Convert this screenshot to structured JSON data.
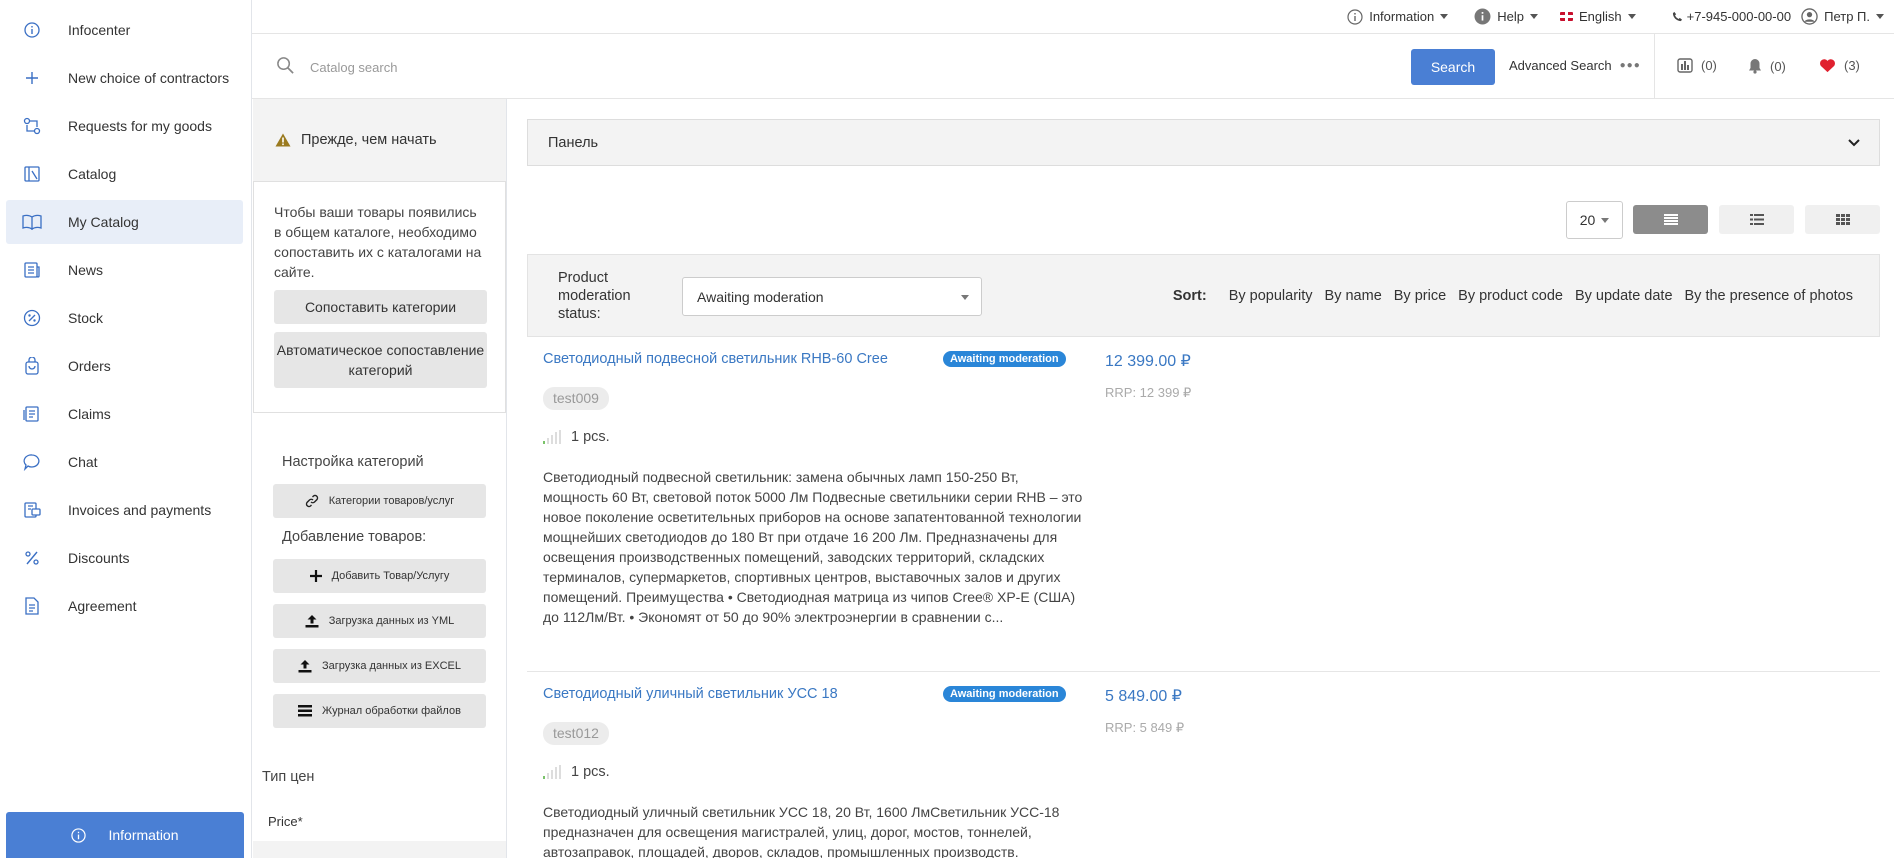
{
  "sidebar": {
    "items": [
      {
        "label": "Infocenter",
        "icon": "info-circle-icon"
      },
      {
        "label": "New choice of contractors",
        "icon": "plus-icon"
      },
      {
        "label": "Requests for my goods",
        "icon": "exchange-icon"
      },
      {
        "label": "Catalog",
        "icon": "catalog-icon"
      },
      {
        "label": "My Catalog",
        "icon": "book-icon",
        "active": true
      },
      {
        "label": "News",
        "icon": "news-icon"
      },
      {
        "label": "Stock",
        "icon": "percent-circle-icon"
      },
      {
        "label": "Orders",
        "icon": "bag-icon"
      },
      {
        "label": "Claims",
        "icon": "claims-icon"
      },
      {
        "label": "Chat",
        "icon": "chat-icon"
      },
      {
        "label": "Invoices and payments",
        "icon": "invoice-icon"
      },
      {
        "label": "Discounts",
        "icon": "percent-icon"
      },
      {
        "label": "Agreement",
        "icon": "document-icon"
      }
    ],
    "info_button": "Information"
  },
  "topbar": {
    "information": "Information",
    "help": "Help",
    "language": "English",
    "phone": "+7-945-000-00-00",
    "user": "Петр П."
  },
  "search": {
    "placeholder": "Catalog search",
    "button": "Search",
    "advanced": "Advanced Search",
    "compare_count": "(0)",
    "notify_count": "(0)",
    "favorites_count": "(3)"
  },
  "leftpanel": {
    "warning": "Прежде, чем начать",
    "intro": "Чтобы ваши товары появились в общем каталоге, необходимо сопоставить их с каталогами на сайте.",
    "map_button": "Сопоставить категории",
    "auto_button": "Автоматическое сопоставление категорий",
    "categories_title": "Настройка категорий",
    "categories_button": "Категории товаров/услуг",
    "add_title": "Добавление товаров:",
    "add_button": "Добавить Товар/Услугу",
    "yml_button": "Загрузка данных из YML",
    "excel_button": "Загрузка данных из EXCEL",
    "log_button": "Журнал обработки файлов",
    "price_type": "Тип цен",
    "price_star": "Price*"
  },
  "main": {
    "panel_label": "Панель",
    "per_page": "20",
    "moderation_label": "Product moderation status:",
    "moderation_value": "Awaiting moderation",
    "sort_label": "Sort:",
    "sort_options": [
      "By popularity",
      "By name",
      "By price",
      "By product code",
      "By update date",
      "By the presence of photos"
    ],
    "products": [
      {
        "title": "Светодиодный подвесной светильник RHB-60 Cree",
        "badge": "Awaiting moderation",
        "sku": "test009",
        "qty": "1 pcs.",
        "description": "Светодиодный подвесной светильник: замена обычных ламп 150-250 Вт, мощность 60 Вт, световой поток 5000 Лм Подвесные светильники серии RHB – это новое поколение осветительных приборов на основе запатентованной технологии мощнейших светодиодов до 180 Вт при отдаче 16 200 Лм. Предназначены для освещения производственных помещений, заводских территорий, складских терминалов, супермаркетов, спортивных центров, выставочных залов и других помещений. Преимущества • Светодиодная матрица из чипов Cree® XP-E (США) до 112Лм/Вт. • Экономят от 50 до 90% электроэнергии в сравнении с...",
        "price": "12 399.00 ₽",
        "rrp": "RRP: 12 399 ₽"
      },
      {
        "title": "Светодиодный уличный светильник УСС 18",
        "badge": "Awaiting moderation",
        "sku": "test012",
        "qty": "1 pcs.",
        "description": "Светодиодный уличный светильник УСС 18, 20 Вт, 1600 ЛмСветильник УСС-18 предназначен для освещения магистралей, улиц, дорог, мостов, тоннелей, автозаправок, площадей, дворов, складов, промышленных производств.",
        "price": "5 849.00 ₽",
        "rrp": "RRP: 5 849 ₽"
      }
    ]
  },
  "colors": {
    "accent": "#4a7fd4",
    "link": "#3a78c3",
    "badge": "#2a86d8",
    "favorite": "#e0212f"
  }
}
